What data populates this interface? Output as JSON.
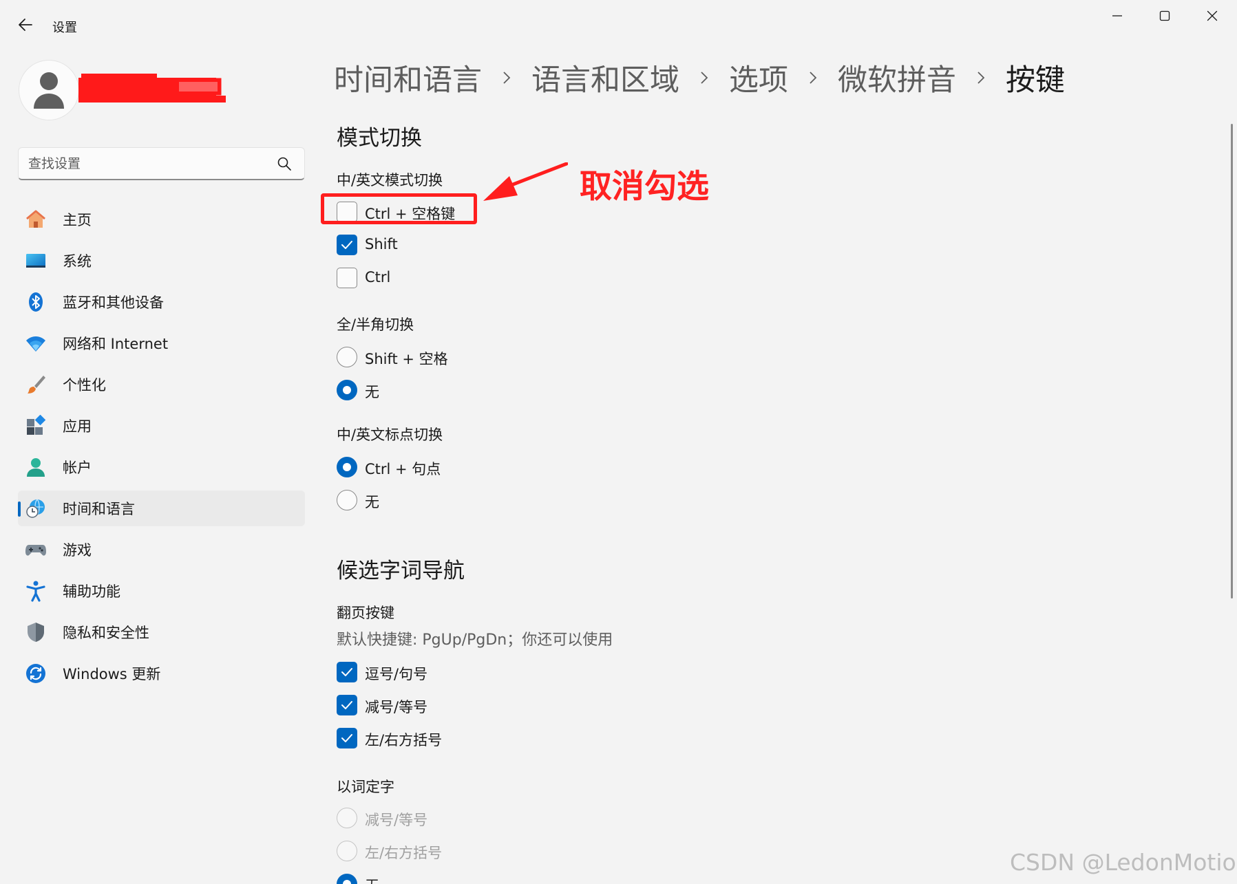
{
  "window": {
    "title": "设置",
    "back_icon": "arrow-left-icon",
    "controls": [
      "minimize-icon",
      "maximize-icon",
      "close-icon"
    ]
  },
  "profile": {
    "avatar_icon": "user-icon",
    "name_redacted": true,
    "redaction_color": "#ff1a1a"
  },
  "search": {
    "placeholder": "查找设置",
    "value": ""
  },
  "sidebar": {
    "items": [
      {
        "label": "主页",
        "icon": "home-icon",
        "active": false
      },
      {
        "label": "系统",
        "icon": "system-icon",
        "active": false
      },
      {
        "label": "蓝牙和其他设备",
        "icon": "bluetooth-icon",
        "active": false
      },
      {
        "label": "网络和 Internet",
        "icon": "wifi-icon",
        "active": false
      },
      {
        "label": "个性化",
        "icon": "brush-icon",
        "active": false
      },
      {
        "label": "应用",
        "icon": "apps-icon",
        "active": false
      },
      {
        "label": "帐户",
        "icon": "account-icon",
        "active": false
      },
      {
        "label": "时间和语言",
        "icon": "time-language-icon",
        "active": true
      },
      {
        "label": "游戏",
        "icon": "gamepad-icon",
        "active": false
      },
      {
        "label": "辅助功能",
        "icon": "accessibility-icon",
        "active": false
      },
      {
        "label": "隐私和安全性",
        "icon": "shield-icon",
        "active": false
      },
      {
        "label": "Windows 更新",
        "icon": "update-icon",
        "active": false
      }
    ]
  },
  "breadcrumb": [
    "时间和语言",
    "语言和区域",
    "选项",
    "微软拼音",
    "按键"
  ],
  "sections": {
    "mode_switch": {
      "title": "模式切换",
      "cn_en_mode": {
        "label": "中/英文模式切换",
        "options": [
          {
            "label": "Ctrl + 空格键",
            "checked": false
          },
          {
            "label": "Shift",
            "checked": true
          },
          {
            "label": "Ctrl",
            "checked": false
          }
        ]
      },
      "full_half": {
        "label": "全/半角切换",
        "options": [
          {
            "label": "Shift + 空格",
            "selected": false
          },
          {
            "label": "无",
            "selected": true
          }
        ]
      },
      "punctuation": {
        "label": "中/英文标点切换",
        "options": [
          {
            "label": "Ctrl + 句点",
            "selected": true
          },
          {
            "label": "无",
            "selected": false
          }
        ]
      }
    },
    "candidate_nav": {
      "title": "候选字词导航",
      "page_keys": {
        "label": "翻页按键",
        "description": "默认快捷键: PgUp/PgDn；你还可以使用",
        "options": [
          {
            "label": "逗号/句号",
            "checked": true
          },
          {
            "label": "减号/等号",
            "checked": true
          },
          {
            "label": "左/右方括号",
            "checked": true
          }
        ]
      },
      "word_select": {
        "label": "以词定字",
        "options": [
          {
            "label": "减号/等号",
            "selected": false,
            "disabled": true
          },
          {
            "label": "左/右方括号",
            "selected": false,
            "disabled": true
          },
          {
            "label": "无",
            "selected": true,
            "disabled": false
          }
        ]
      }
    }
  },
  "annotation": {
    "text": "取消勾选",
    "color": "#ff1e1e"
  },
  "watermark": "CSDN @LedonMotion",
  "colors": {
    "accent": "#0067c0",
    "background": "#f3f3f3",
    "annotation": "#ff1e1e"
  }
}
